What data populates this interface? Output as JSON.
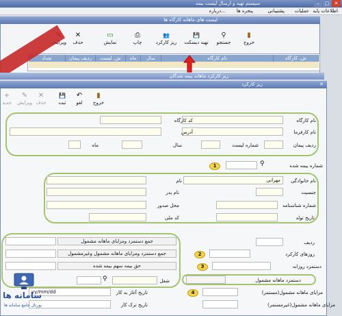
{
  "menubar": [
    "اطلاعات پایه",
    "عملیات",
    "پشتیبانی",
    "پنجره ها",
    "درباره..."
  ],
  "main_window": {
    "title": "سیستم تهیه و ارسال لیست بیمه",
    "subwindow_title": "لیست های ماهانه کارگاه ها",
    "toolbar": [
      {
        "label": "خروج",
        "icon": "door-icon",
        "glyph": "▮"
      },
      {
        "label": "جستجو",
        "icon": "binoculars-icon",
        "glyph": "⚲"
      },
      {
        "label": "تهیه دیسکت",
        "icon": "disk-icon",
        "glyph": "💾"
      },
      {
        "label": "ریز کارکرد",
        "icon": "people-icon",
        "glyph": "👥"
      },
      {
        "label": "چاپ",
        "icon": "printer-icon",
        "glyph": "⎙"
      },
      {
        "label": "نمایش",
        "icon": "display-icon",
        "glyph": "▭"
      },
      {
        "label": "حذف",
        "icon": "delete-icon",
        "glyph": "✕"
      },
      {
        "label": "ویرایش",
        "icon": "edit-icon",
        "glyph": "✎"
      }
    ],
    "columns": [
      "ش. کارگاه",
      "نام کارگاه",
      "سال",
      "ماه",
      "ش. لیست",
      "ردیف پیمان",
      "تعداد"
    ]
  },
  "second_window": {
    "title": "ریز کارکرد ماهانه بیمه شدگان"
  },
  "dialog": {
    "title": "ریز کارکرد",
    "toolbar": [
      {
        "label": "خروج",
        "icon": "door-icon",
        "glyph": "▮"
      },
      {
        "label": "لغو",
        "icon": "undo-icon",
        "glyph": "↶"
      },
      {
        "label": "ثبت",
        "icon": "save-icon",
        "glyph": "💾"
      },
      {
        "label": "حذف",
        "icon": "delete-icon",
        "glyph": "✕"
      },
      {
        "label": "ویرایش",
        "icon": "edit-icon",
        "glyph": "✎"
      },
      {
        "label": "جدید",
        "icon": "new-icon",
        "glyph": "+"
      }
    ],
    "workshop": {
      "name_label": "نام کارگاه",
      "code_label": "کد کارگاه",
      "employer_label": "نام کارفرما",
      "address_label": "آدرس",
      "contract_label": "ردیف پیمان",
      "list_no_label": "شماره لیست",
      "year_label": "سال",
      "month_label": "ماه"
    },
    "insurance_no_label": "شماره بیمه شده",
    "person": {
      "family_label": "نام خانوادگی",
      "family_value": "مهرانی",
      "first_label": "نام",
      "gender_label": "جنسیت",
      "father_label": "نام پدر",
      "id_no_label": "شماره شناسنامه",
      "issue_place_label": "محل صدور",
      "birth_label": "تاریخ تولد",
      "national_code_label": "کد ملی"
    },
    "work": {
      "row_label": "ردیف",
      "days_label": "روزهای کارکرد",
      "daily_wage_label": "دستمزد روزانه",
      "monthly_wage_label": "دستمزد ماهانه مشمول",
      "benefits_cont_label": "مزایای ماهانه مشمول(مستمر)",
      "benefits_noncont_label": "مزایای ماهانه مشمول(غیرمستمر)",
      "start_date_label": "تاریخ آغاز به کار",
      "end_date_label": "تاریخ ترک کار",
      "job_label": "شغل",
      "date_placeholder": "yy/mm/dd"
    },
    "totals": {
      "sum1_label": "جمع دستمزد ومزایای ماهانه مشمول",
      "sum2_label": "جمع دستمزد ومزایای ماهانه مشمول وغیرمشمول",
      "insured_share_label": "حق بیمه سهم بیمه شده"
    }
  },
  "callouts": [
    "1",
    "2",
    "3",
    "4"
  ],
  "watermark": {
    "line1": "سامانه ها",
    "line2": "پورتال جامع سامانه ها"
  },
  "colors": {
    "accent_green": "#a3c46c",
    "title_blue": "#3f64a8",
    "field_yellow": "#fffff0",
    "arrow_red": "#e02020"
  }
}
